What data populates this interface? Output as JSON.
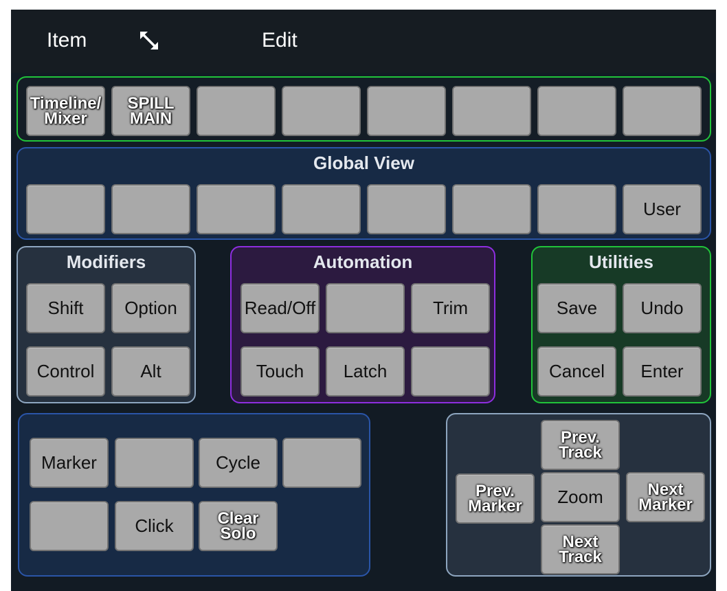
{
  "menu": {
    "item_label": "Item",
    "edit_label": "Edit",
    "resize_icon": "resize-diagonal-icon"
  },
  "top_row": [
    "Timeline/\nMixer",
    "SPILL\nMAIN",
    "",
    "",
    "",
    "",
    "",
    ""
  ],
  "global_view": {
    "title": "Global View",
    "buttons": [
      "",
      "",
      "",
      "",
      "",
      "",
      "",
      "User"
    ]
  },
  "modifiers": {
    "title": "Modifiers",
    "buttons": [
      "Shift",
      "Option",
      "Control",
      "Alt"
    ]
  },
  "automation": {
    "title": "Automation",
    "buttons": [
      "Read/Off",
      "",
      "Trim",
      "Touch",
      "Latch",
      ""
    ]
  },
  "utilities": {
    "title": "Utilities",
    "buttons": [
      "Save",
      "Undo",
      "Cancel",
      "Enter"
    ]
  },
  "transport": {
    "buttons": [
      "Marker",
      "",
      "Cycle",
      "",
      "",
      "Click",
      "Clear\nSolo"
    ]
  },
  "navigation": {
    "prev_track": "Prev.\nTrack",
    "prev_marker": "Prev.\nMarker",
    "zoom": "Zoom",
    "next_marker": "Next\nMarker",
    "next_track": "Next\nTrack"
  },
  "colors": {
    "background": "#121b24",
    "green_border": "#21c43a",
    "blue_border": "#2a55a8",
    "light_border": "#8ea6c0",
    "purple_border": "#8e2ee0",
    "button_fill": "#a9a9a9"
  }
}
